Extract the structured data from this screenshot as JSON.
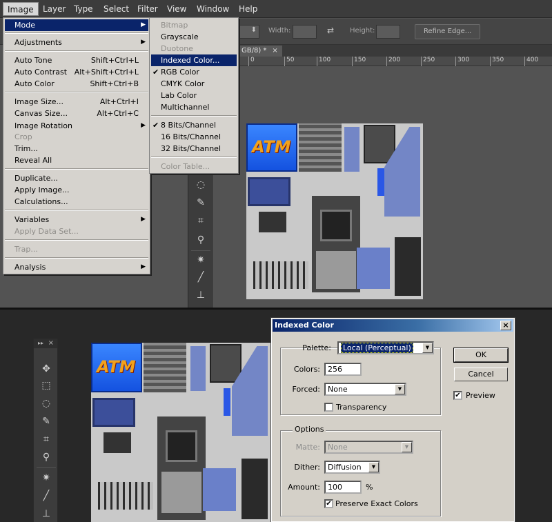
{
  "menubar": {
    "items": [
      "Image",
      "Layer",
      "Type",
      "Select",
      "Filter",
      "View",
      "Window",
      "Help"
    ]
  },
  "options_bar": {
    "width_label": "Width:",
    "height_label": "Height:",
    "refine_edge_label": "Refine Edge..."
  },
  "document_tab": {
    "title": "GB/8) *",
    "close": "×"
  },
  "ruler": {
    "ticks": [
      "0",
      "50",
      "100",
      "150",
      "200",
      "250",
      "300",
      "350",
      "400"
    ]
  },
  "image_menu": {
    "items": [
      {
        "label": "Mode",
        "shortcut": "",
        "submenu": true,
        "highlighted": true,
        "disabled": false
      },
      {
        "label": "Adjustments",
        "shortcut": "",
        "submenu": true,
        "disabled": false
      },
      {
        "label": "Auto Tone",
        "shortcut": "Shift+Ctrl+L",
        "disabled": false
      },
      {
        "label": "Auto Contrast",
        "shortcut": "Alt+Shift+Ctrl+L",
        "disabled": false
      },
      {
        "label": "Auto Color",
        "shortcut": "Shift+Ctrl+B",
        "disabled": false
      },
      {
        "label": "Image Size...",
        "shortcut": "Alt+Ctrl+I",
        "disabled": false
      },
      {
        "label": "Canvas Size...",
        "shortcut": "Alt+Ctrl+C",
        "disabled": false
      },
      {
        "label": "Image Rotation",
        "shortcut": "",
        "submenu": true,
        "disabled": false
      },
      {
        "label": "Crop",
        "shortcut": "",
        "disabled": true
      },
      {
        "label": "Trim...",
        "shortcut": "",
        "disabled": false
      },
      {
        "label": "Reveal All",
        "shortcut": "",
        "disabled": false
      },
      {
        "label": "Duplicate...",
        "shortcut": "",
        "disabled": false
      },
      {
        "label": "Apply Image...",
        "shortcut": "",
        "disabled": false
      },
      {
        "label": "Calculations...",
        "shortcut": "",
        "disabled": false
      },
      {
        "label": "Variables",
        "shortcut": "",
        "submenu": true,
        "disabled": false
      },
      {
        "label": "Apply Data Set...",
        "shortcut": "",
        "disabled": true
      },
      {
        "label": "Trap...",
        "shortcut": "",
        "disabled": true
      },
      {
        "label": "Analysis",
        "shortcut": "",
        "submenu": true,
        "disabled": false
      }
    ]
  },
  "mode_menu": {
    "items": [
      {
        "label": "Bitmap",
        "disabled": true
      },
      {
        "label": "Grayscale",
        "disabled": false
      },
      {
        "label": "Duotone",
        "disabled": true
      },
      {
        "label": "Indexed Color...",
        "disabled": false,
        "highlighted": true
      },
      {
        "label": "RGB Color",
        "disabled": false,
        "checked": true
      },
      {
        "label": "CMYK Color",
        "disabled": false
      },
      {
        "label": "Lab Color",
        "disabled": false
      },
      {
        "label": "Multichannel",
        "disabled": false
      },
      {
        "label": "8 Bits/Channel",
        "disabled": false,
        "checked": true
      },
      {
        "label": "16 Bits/Channel",
        "disabled": false
      },
      {
        "label": "32 Bits/Channel",
        "disabled": false
      },
      {
        "label": "Color Table...",
        "disabled": true
      }
    ]
  },
  "texture": {
    "logo_text": "ATM"
  },
  "panel_header": {
    "collapse": "▸▸",
    "close": "×"
  },
  "dialog": {
    "title": "Indexed Color",
    "close": "×",
    "palette_label": "Palette:",
    "palette_value": "Local (Perceptual)",
    "colors_label": "Colors:",
    "colors_value": "256",
    "forced_label": "Forced:",
    "forced_value": "None",
    "transparency_label": "Transparency",
    "transparency_checked": false,
    "options_title": "Options",
    "matte_label": "Matte:",
    "matte_value": "None",
    "dither_label": "Dither:",
    "dither_value": "Diffusion",
    "amount_label": "Amount:",
    "amount_value": "100",
    "amount_unit": "%",
    "preserve_label": "Preserve Exact Colors",
    "preserve_checked": true,
    "ok_label": "OK",
    "cancel_label": "Cancel",
    "preview_label": "Preview",
    "preview_checked": true,
    "check_mark": "✔",
    "dropdown_arrow": "▼"
  },
  "colors": {
    "menu_highlight": "#0a246a",
    "menu_bg": "#d6d3ce",
    "dialog_bg": "#d4d0c8",
    "atm_blue": "#1f6cf0",
    "atm_text": "#f2a21b",
    "panel_blue": "#7386c6"
  },
  "icons": {
    "move": "move-icon",
    "marquee": "marquee-icon",
    "lasso": "lasso-icon",
    "quick_select": "quick-select-icon",
    "crop": "crop-icon",
    "eyedropper": "eyedropper-icon",
    "healing": "healing-brush-icon",
    "brush": "brush-icon",
    "stamp": "clone-stamp-icon"
  }
}
